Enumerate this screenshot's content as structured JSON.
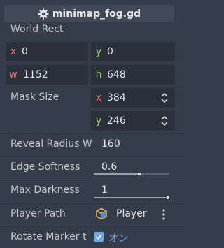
{
  "header": {
    "title": "minimap_fog.gd",
    "icon": "gear-icon"
  },
  "world_rect": {
    "label": "World Rect",
    "x_axis": "x",
    "x_value": "0",
    "y_axis": "y",
    "y_value": "0",
    "w_axis": "w",
    "w_value": "1152",
    "h_axis": "h",
    "h_value": "648"
  },
  "mask_size": {
    "label": "Mask Size",
    "x_axis": "x",
    "x_value": "384",
    "y_axis": "y",
    "y_value": "246"
  },
  "reveal_radius": {
    "label": "Reveal Radius W",
    "value": "160"
  },
  "edge_softness": {
    "label": "Edge Softness",
    "value": "0.6",
    "level": 0.6
  },
  "max_darkness": {
    "label": "Max Darkness",
    "value": "1",
    "level": 1.0
  },
  "player_path": {
    "label": "Player Path",
    "value": "Player",
    "icon": "node3d-icon"
  },
  "rotate_marker": {
    "label": "Rotate Marker t",
    "value": "オン",
    "checked": true
  },
  "colors": {
    "axis_x": "#e2796d",
    "axis_y": "#a3d46f",
    "accent": "#6fa8e8"
  }
}
